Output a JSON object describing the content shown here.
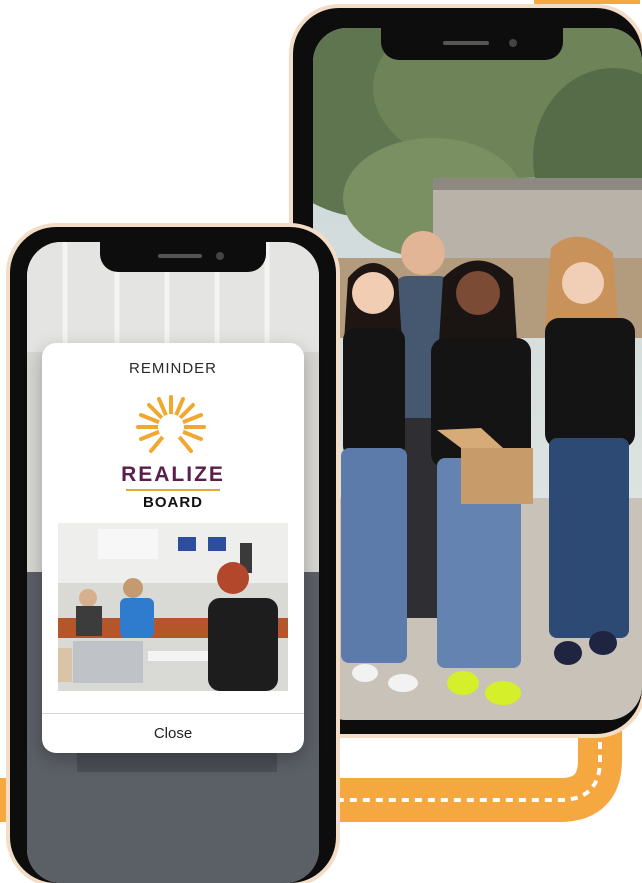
{
  "reminder": {
    "title": "REMINDER",
    "logo_word": "REALIZE",
    "logo_sub": "BOARD",
    "close_label": "Close"
  },
  "colors": {
    "brand_purple": "#5a1e4a",
    "brand_gold": "#e8a53a",
    "road_orange": "#f6a840"
  },
  "images": {
    "right_phone_photo": "group-of-four-people-outdoors-photo",
    "left_phone_background": "conference-room-photo",
    "modal_photo": "meeting-room-with-laptops-photo"
  }
}
